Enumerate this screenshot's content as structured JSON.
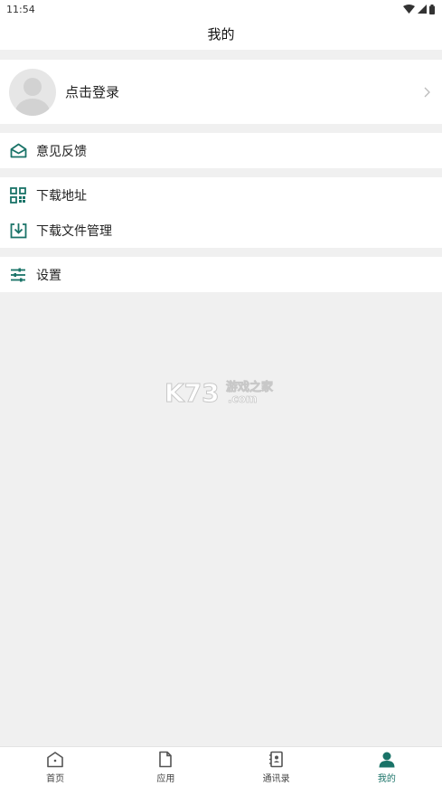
{
  "status_bar": {
    "time": "11:54",
    "icons": [
      "wifi-icon",
      "signal-icon",
      "battery-icon"
    ]
  },
  "header": {
    "title": "我的"
  },
  "login": {
    "label": "点击登录",
    "avatar_icon": "default-avatar-icon",
    "arrow_icon": "chevron-right-icon"
  },
  "menu": {
    "feedback": {
      "label": "意见反馈",
      "icon": "mail-open-icon"
    },
    "download_address": {
      "label": "下载地址",
      "icon": "qr-code-icon"
    },
    "download_manager": {
      "label": "下载文件管理",
      "icon": "download-tray-icon"
    },
    "settings": {
      "label": "设置",
      "icon": "sliders-icon"
    }
  },
  "watermark": {
    "brand": "K73",
    "cn": "游戏之家",
    "domain": ".com"
  },
  "bottom_nav": {
    "items": [
      {
        "label": "首页",
        "icon": "home-icon",
        "active": false
      },
      {
        "label": "应用",
        "icon": "file-icon",
        "active": false
      },
      {
        "label": "通讯录",
        "icon": "contacts-icon",
        "active": false
      },
      {
        "label": "我的",
        "icon": "person-icon",
        "active": true
      }
    ]
  },
  "colors": {
    "accent": "#1a7368",
    "page_bg": "#f0f0f0",
    "card_bg": "#ffffff"
  }
}
